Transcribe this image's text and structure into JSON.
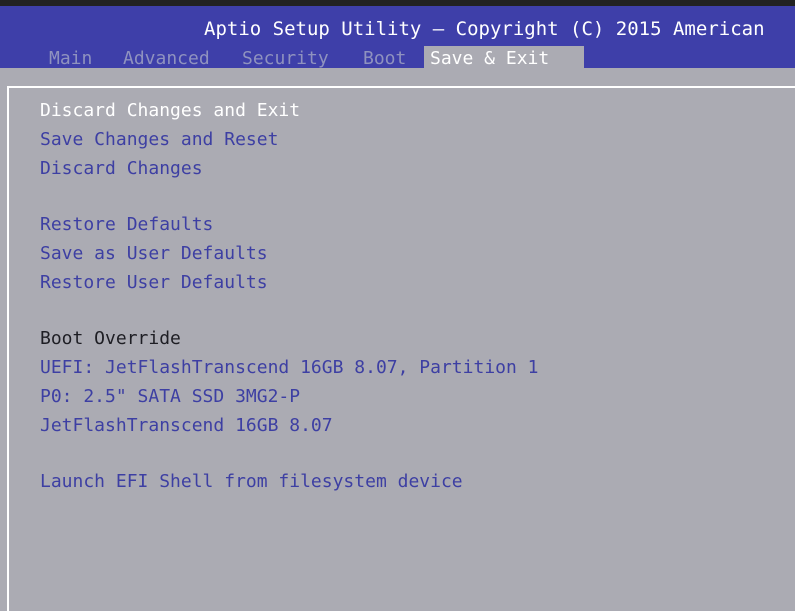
{
  "header": {
    "title": "Aptio Setup Utility – Copyright (C) 2015 American",
    "tabs": [
      {
        "label": "Main"
      },
      {
        "label": "Advanced"
      },
      {
        "label": "Security"
      },
      {
        "label": "Boot"
      },
      {
        "label": "Save & Exit",
        "active": true
      }
    ]
  },
  "menu": {
    "discard_changes_and_exit": "Discard Changes and Exit",
    "save_changes_and_reset": "Save Changes and Reset",
    "discard_changes": "Discard Changes",
    "restore_defaults": "Restore Defaults",
    "save_as_user_defaults": "Save as User Defaults",
    "restore_user_defaults": "Restore User Defaults",
    "boot_override_label": "Boot Override",
    "boot_options": [
      "UEFI: JetFlashTranscend 16GB 8.07, Partition 1",
      "P0: 2.5\" SATA SSD 3MG2-P",
      "JetFlashTranscend 16GB 8.07"
    ],
    "launch_efi_shell": "Launch EFI Shell from filesystem device"
  },
  "colors": {
    "header_bg": "#3e3fa9",
    "body_bg": "#ababb3",
    "item_text": "#3d3fa3",
    "selected_text": "#ffffff",
    "inactive_tab": "#8f92bf"
  }
}
